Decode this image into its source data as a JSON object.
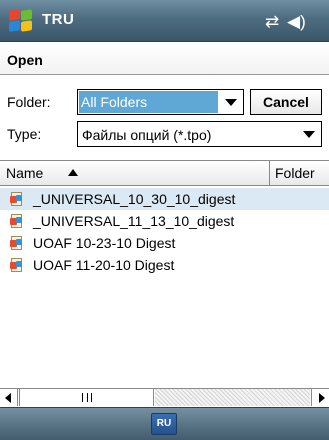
{
  "titlebar": {
    "app_title": "TRU",
    "icons": [
      "windows-start-icon",
      "connectivity-icon",
      "volume-icon"
    ]
  },
  "dialog": {
    "title": "Open",
    "folder_label": "Folder:",
    "folder_value": "All Folders",
    "cancel_label": "Cancel",
    "type_label": "Type:",
    "type_value": "Файлы опций (*.tpo)"
  },
  "list": {
    "columns": [
      "Name",
      "Folder"
    ],
    "sort": "ascending",
    "files": [
      "_UNIVERSAL_10_30_10_digest",
      "_UNIVERSAL_11_13_10_digest",
      "UOAF 10-23-10 Digest",
      "UOAF 11-20-10 Digest"
    ],
    "selected_index": 0
  },
  "bottombar": {
    "input_indicator": "RU"
  },
  "colors": {
    "titlebar": "#4e6c80",
    "selection": "#5fa8d6",
    "row_highlight": "#dbe9f4"
  }
}
